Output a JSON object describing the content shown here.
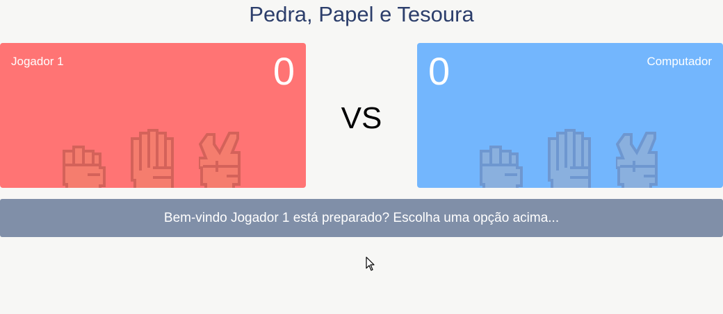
{
  "game": {
    "title": "Pedra, Papel e Tesoura",
    "vs_label": "VS"
  },
  "player": {
    "name": "Jogador 1",
    "score": "0",
    "choices": [
      "fist-icon",
      "open-hand-icon",
      "victory-hand-icon"
    ]
  },
  "computer": {
    "name": "Computador",
    "score": "0",
    "choices": [
      "fist-icon",
      "open-hand-icon",
      "victory-hand-icon"
    ]
  },
  "status": {
    "message": "Bem-vindo Jogador 1 está preparado? Escolha uma opção acima..."
  },
  "colors": {
    "player_panel": "#ff7474",
    "player_hand": "#f57d6e",
    "computer_panel": "#73b6fd",
    "computer_hand": "#8ab0de",
    "message_bar": "#808fa8",
    "title": "#2c3e6b"
  }
}
